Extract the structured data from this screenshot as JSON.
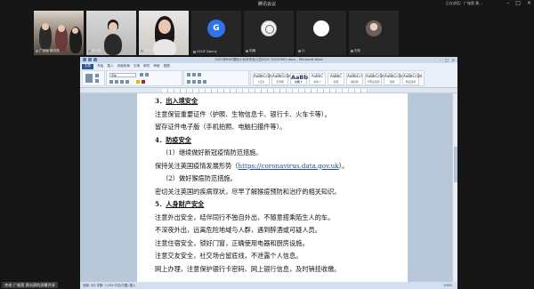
{
  "meeting": {
    "title": "腾讯会议",
    "speaking": "正在讲话：广城营 黄..."
  },
  "participants": [
    {
      "name": "广城营 黄向燕",
      "kind": "video"
    },
    {
      "name": "秦小雨",
      "kind": "video"
    },
    {
      "name": "鲁诗萍",
      "kind": "video"
    },
    {
      "name": "GCUF Danny",
      "kind": "avatar",
      "avatar_text": "G"
    },
    {
      "name": "向婉",
      "kind": "avatar"
    },
    {
      "name": "小",
      "kind": "avatar"
    },
    {
      "name": "刘亦",
      "kind": "avatar"
    }
  ],
  "word": {
    "doc_title": "2022年BHE国际小伙伴安全公告2022 20220901.docx - Microsoft Word",
    "tabs": [
      "文件",
      "开始",
      "插入",
      "页面布局",
      "引用",
      "邮件",
      "审阅",
      "视图"
    ],
    "font_name": "宋体",
    "styles": [
      {
        "preview": "AaBbCcDd",
        "name": "1正文"
      },
      {
        "preview": "AaBbCcDd",
        "name": "无间隔"
      },
      {
        "preview": "AaBb",
        "name": "标题 1"
      },
      {
        "preview": "AaBbC",
        "name": "标题 2"
      },
      {
        "preview": "AaBbC",
        "name": "标题"
      },
      {
        "preview": "AaBbCcI",
        "name": "副标题"
      },
      {
        "preview": "AaBbCcDd",
        "name": "不明显强调"
      },
      {
        "preview": "AaBbCcDd",
        "name": "强调"
      },
      {
        "preview": "AaBbCcDd",
        "name": "明显强调"
      }
    ],
    "status_left": "页面: 3/5  字数: 2,105  中文(中国)  插入",
    "status_zoom": "100%"
  },
  "doc": {
    "lines": [
      {
        "type": "heading",
        "num": "3．",
        "text": "出入境安全"
      },
      {
        "type": "body",
        "text": "注意保管重要证件（护照、生物信息卡、银行卡、火车卡等）。"
      },
      {
        "type": "body",
        "text": "留存证件电子版（手机拍照、电脑扫描件等）。"
      },
      {
        "type": "heading",
        "num": "4．",
        "text": "防疫安全"
      },
      {
        "type": "body2",
        "text": "（1）继续做好新冠疫情防范措施。"
      },
      {
        "type": "link",
        "before": "保持关注英国疫情发展形势（",
        "link": "https://coronavirus.data.gov.uk",
        "after": "）。"
      },
      {
        "type": "body2",
        "text": "（2）做好猴痘防范措施。"
      },
      {
        "type": "body",
        "text": "密切关注英国的疾病现状，尽早了解猴痘预防和治疗的相关知识。"
      },
      {
        "type": "heading",
        "num": "5．",
        "text": "人身财产安全"
      },
      {
        "type": "body",
        "text": "注意外出安全，结伴同行不独自外出，不随意搭乘陌生人的车。"
      },
      {
        "type": "body",
        "text": "不深夜外出，远离危险地域与人群，遇到醉酒或可疑人员。"
      },
      {
        "type": "body",
        "text": "注意住宿安全，锁好门窗，正确使用电器和厨房设施。"
      },
      {
        "type": "body",
        "text": "注意交友安全，社交场合留底线，不泄露个人信息。"
      },
      {
        "type": "body",
        "text": "网上办理，注意保护银行卡密码、网上银行信息，及时销挂收缴。"
      }
    ]
  },
  "share_label": "李老 广城营 黄向燕的屏幕共享",
  "colors": {
    "meeting_bg": "#161616",
    "word_blue": "#2a5699",
    "link": "#1f4aa8",
    "avatar_blue": "#2f72f0"
  }
}
